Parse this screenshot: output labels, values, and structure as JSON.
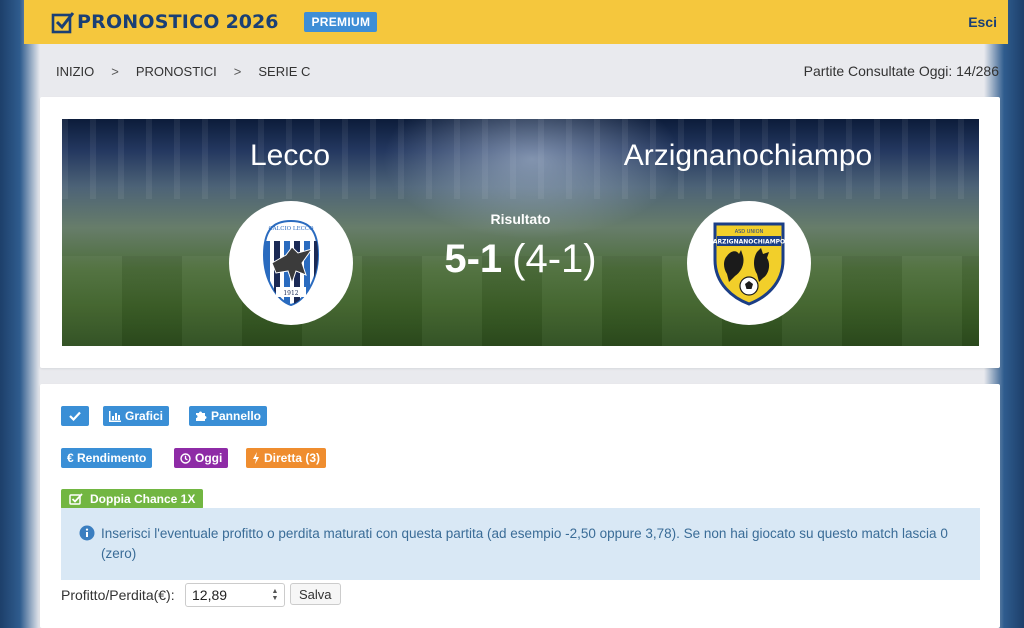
{
  "header": {
    "logo_text": "PRONOSTICO",
    "logo_year": "2026",
    "premium_badge": "PREMIUM",
    "logout": "Esci",
    "colors": {
      "bar": "#f5c73d",
      "brand": "#1a3f75",
      "badge": "#3e8ed6"
    }
  },
  "breadcrumb": {
    "items": [
      "INIZIO",
      "PRONOSTICI",
      "SERIE C"
    ],
    "separator": ">"
  },
  "visits": "Partite Consultate Oggi: 14/286",
  "match": {
    "home_team": "Lecco",
    "away_team": "Arzignanochiampo",
    "result_label": "Risultato",
    "score": "5-1",
    "halftime": "(4-1)",
    "home_crest": {
      "icon": "lecco-crest-icon",
      "top_text": "CALCIO LECCO",
      "year": "1912"
    },
    "away_crest": {
      "icon": "arzignanochiampo-crest-icon",
      "top_text": "ASD UNION",
      "name_text": "ARZIGNANOCHIAMPO"
    }
  },
  "actions": {
    "check_icon": "check-icon",
    "grafici": "Grafici",
    "pannello": "Pannello",
    "rendimento": "€ Rendimento",
    "oggi": "Oggi",
    "diretta": "Diretta (3)",
    "doppia_chance": "Doppia Chance 1X",
    "colors": {
      "blue": "#3a8fd6",
      "purple": "#8e2ba6",
      "orange": "#ef8d2f",
      "green": "#72b642"
    }
  },
  "info": {
    "text": "Inserisci l'eventuale profitto o perdita maturati con questa partita (ad esempio -2,50 oppure 3,78). Se non hai giocato su questo match lascia 0 (zero)"
  },
  "profit": {
    "label": "Profitto/Perdita(€):",
    "value": "12,89",
    "save": "Salva"
  }
}
